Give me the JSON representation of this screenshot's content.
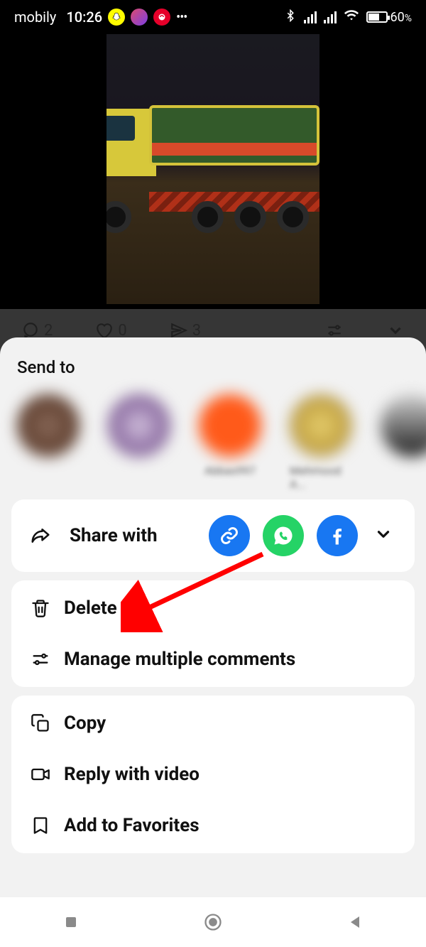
{
  "status": {
    "carrier": "mobily",
    "time": "10:26",
    "battery_pct": "60",
    "battery_pct_sym": "%"
  },
  "behind": {
    "comment_count": "2",
    "like_count": "0",
    "share_count": "3"
  },
  "sheet": {
    "send_title": "Send to",
    "contacts": [
      {
        "name": ""
      },
      {
        "name": ""
      },
      {
        "name": "Abbas997"
      },
      {
        "name": "Mehmood A..."
      },
      {
        "name": ""
      }
    ],
    "share_with_label": "Share with",
    "actions_group1": [
      {
        "key": "delete",
        "label": "Delete"
      },
      {
        "key": "manage-comments",
        "label": "Manage multiple comments"
      }
    ],
    "actions_group2": [
      {
        "key": "copy",
        "label": "Copy"
      },
      {
        "key": "reply-video",
        "label": "Reply with video"
      },
      {
        "key": "add-favorites",
        "label": "Add to Favorites"
      }
    ]
  }
}
